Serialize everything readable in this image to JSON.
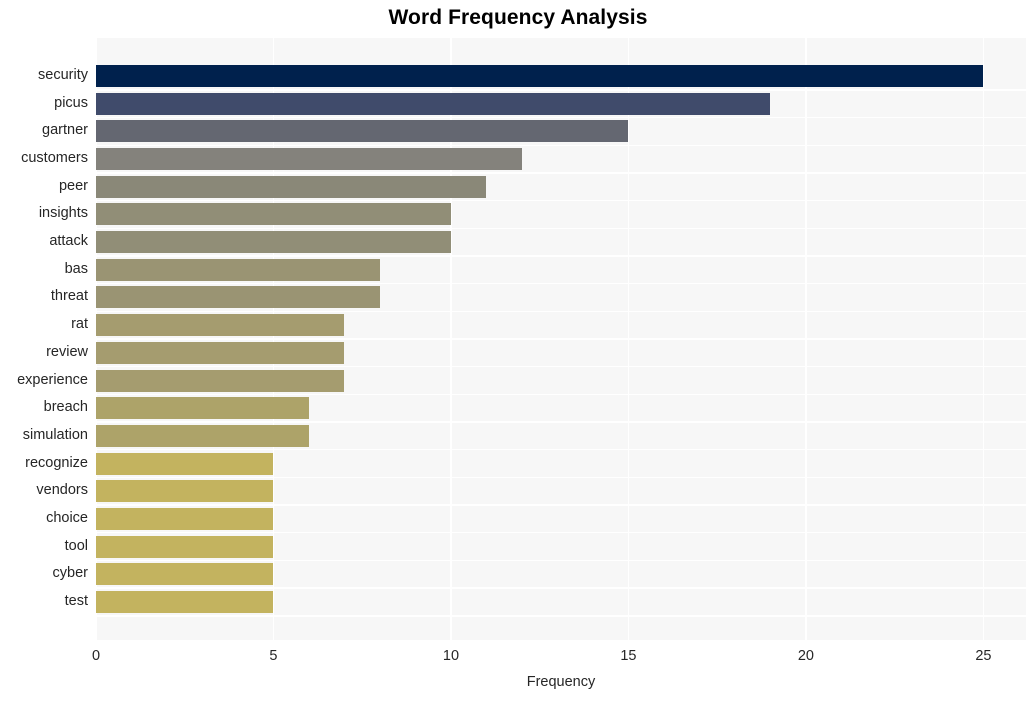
{
  "chart_data": {
    "type": "bar",
    "orientation": "horizontal",
    "title": "Word Frequency Analysis",
    "xlabel": "Frequency",
    "ylabel": "",
    "xlim": [
      0,
      26.2
    ],
    "xticks": [
      0,
      5,
      10,
      15,
      20,
      25
    ],
    "xtick_labels": [
      "0",
      "5",
      "10",
      "15",
      "20",
      "25"
    ],
    "grid": true,
    "grid_color": "#ffffff",
    "plot_background": "#f7f7f7",
    "figure_background": "#ffffff",
    "legend": null,
    "categories": [
      "security",
      "picus",
      "gartner",
      "customers",
      "peer",
      "insights",
      "attack",
      "bas",
      "threat",
      "rat",
      "review",
      "experience",
      "breach",
      "simulation",
      "recognize",
      "vendors",
      "choice",
      "tool",
      "cyber",
      "test"
    ],
    "values": [
      25,
      19,
      15,
      12,
      11,
      10,
      10,
      8,
      8,
      7,
      7,
      7,
      6,
      6,
      5,
      5,
      5,
      5,
      5,
      5
    ],
    "bar_colors": [
      "#00214d",
      "#404b6b",
      "#646771",
      "#84827c",
      "#8a8878",
      "#918e77",
      "#918e77",
      "#9a9473",
      "#9a9473",
      "#a59c6f",
      "#a59c6f",
      "#a59c6f",
      "#ada369",
      "#ada369",
      "#c3b35f",
      "#c3b35f",
      "#c3b35f",
      "#c3b35f",
      "#c3b35f",
      "#c3b35f"
    ]
  }
}
